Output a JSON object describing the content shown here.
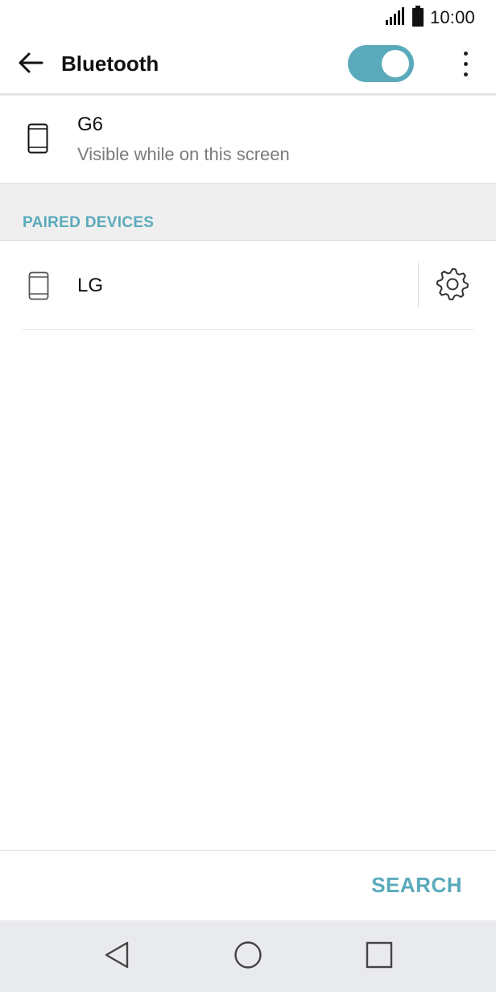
{
  "status_bar": {
    "time": "10:00",
    "signal_icon": "signal-icon",
    "battery_icon": "battery-icon"
  },
  "app_bar": {
    "title": "Bluetooth",
    "back_icon": "arrow-back-icon",
    "toggle_state": "on",
    "overflow_icon": "more-vert-icon"
  },
  "this_device": {
    "name": "G6",
    "subtitle": "Visible while on this screen",
    "icon": "phone-icon"
  },
  "paired_section": {
    "header": "PAIRED DEVICES"
  },
  "paired_devices": [
    {
      "name": "LG",
      "icon": "phone-icon",
      "settings_icon": "gear-icon"
    }
  ],
  "footer": {
    "search_label": "SEARCH"
  },
  "nav_bar": {
    "back_icon": "nav-back-icon",
    "home_icon": "nav-home-icon",
    "recents_icon": "nav-recents-icon"
  },
  "colors": {
    "accent": "#5aaabb",
    "toggle_track": "#5aaabb",
    "section_bg": "#efefef",
    "nav_bg": "#e9eaed"
  }
}
